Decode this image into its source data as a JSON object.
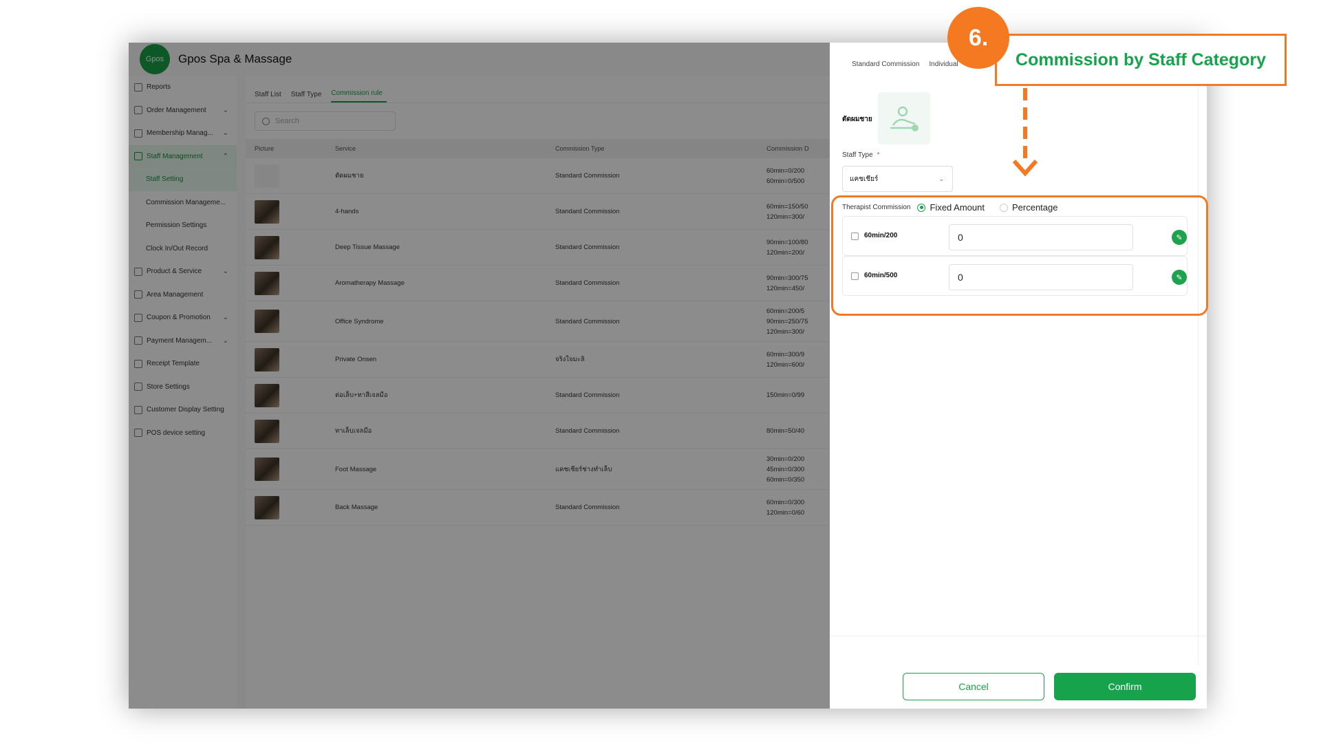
{
  "app": {
    "brand": "Gpos Spa & Massage",
    "logo_text": "Gpos"
  },
  "sidebar": {
    "items": [
      {
        "label": "Reports"
      },
      {
        "label": "Order Management"
      },
      {
        "label": "Membership Manag..."
      },
      {
        "label": "Staff Management"
      },
      {
        "label": "Staff Setting"
      },
      {
        "label": "Commission Manageme..."
      },
      {
        "label": "Permission Settings"
      },
      {
        "label": "Clock In/Out Record"
      },
      {
        "label": "Product & Service"
      },
      {
        "label": "Area Management"
      },
      {
        "label": "Coupon & Promotion"
      },
      {
        "label": "Payment Managem..."
      },
      {
        "label": "Receipt Template"
      },
      {
        "label": "Store Settings"
      },
      {
        "label": "Customer Display Setting"
      },
      {
        "label": "POS device setting"
      }
    ]
  },
  "main": {
    "tabs": [
      "Staff List",
      "Staff Type",
      "Commission rule"
    ],
    "search_placeholder": "Search",
    "columns": [
      "Picture",
      "Service",
      "Commission Type",
      "Commission D"
    ],
    "rows": [
      {
        "service": "ตัดผมชาย",
        "type": "Standard Commission",
        "commission": "60min=0/200\n60min=0/500"
      },
      {
        "service": "4-hands",
        "type": "Standard Commission",
        "commission": "60min=150/50\n120min=300/"
      },
      {
        "service": "Deep Tissue Massage",
        "type": "Standard Commission",
        "commission": "90min=100/80\n120min=200/"
      },
      {
        "service": "Aromatherapy Massage",
        "type": "Standard Commission",
        "commission": "90min=300/75\n120min=450/"
      },
      {
        "service": "Office Syndrome",
        "type": "Standard Commission",
        "commission": "60min=200/5\n90min=250/75\n120min=300/"
      },
      {
        "service": "Private Onsen",
        "type": "จริงใจมะลิ",
        "commission": "60min=300/9\n120min=600/"
      },
      {
        "service": "ต่อเล็บ+ทาสีเจลมือ",
        "type": "Standard Commission",
        "commission": "150min=0/99"
      },
      {
        "service": "ทาเล็บเจลมือ",
        "type": "Standard Commission",
        "commission": "80min=50/40"
      },
      {
        "service": "Foot Massage",
        "type": "แคชเชียร์ช่างทำเล็บ",
        "commission": "30min=0/200\n45min=0/300\n60min=0/350"
      },
      {
        "service": "Back Massage",
        "type": "Standard Commission",
        "commission": "60min=0/300\n120min=0/60"
      }
    ]
  },
  "drawer": {
    "tabs": [
      "Standard Commission",
      "Individual"
    ],
    "service_name": "ตัดผมชาย",
    "staff_type_label": "Staff Type",
    "required_mark": "*",
    "staff_type_value": "แคชเชียร์",
    "therapist_commission_label": "Therapist Commission",
    "radio_fixed": "Fixed Amount",
    "radio_percentage": "Percentage",
    "entries": [
      {
        "duration": "60min/200",
        "value": "0"
      },
      {
        "duration": "60min/500",
        "value": "0"
      }
    ],
    "cancel_label": "Cancel",
    "confirm_label": "Confirm"
  },
  "annotation": {
    "step": "6.",
    "callout": "Commission by Staff Category"
  },
  "colors": {
    "accent": "#17a24c",
    "annotation": "#f47920"
  }
}
